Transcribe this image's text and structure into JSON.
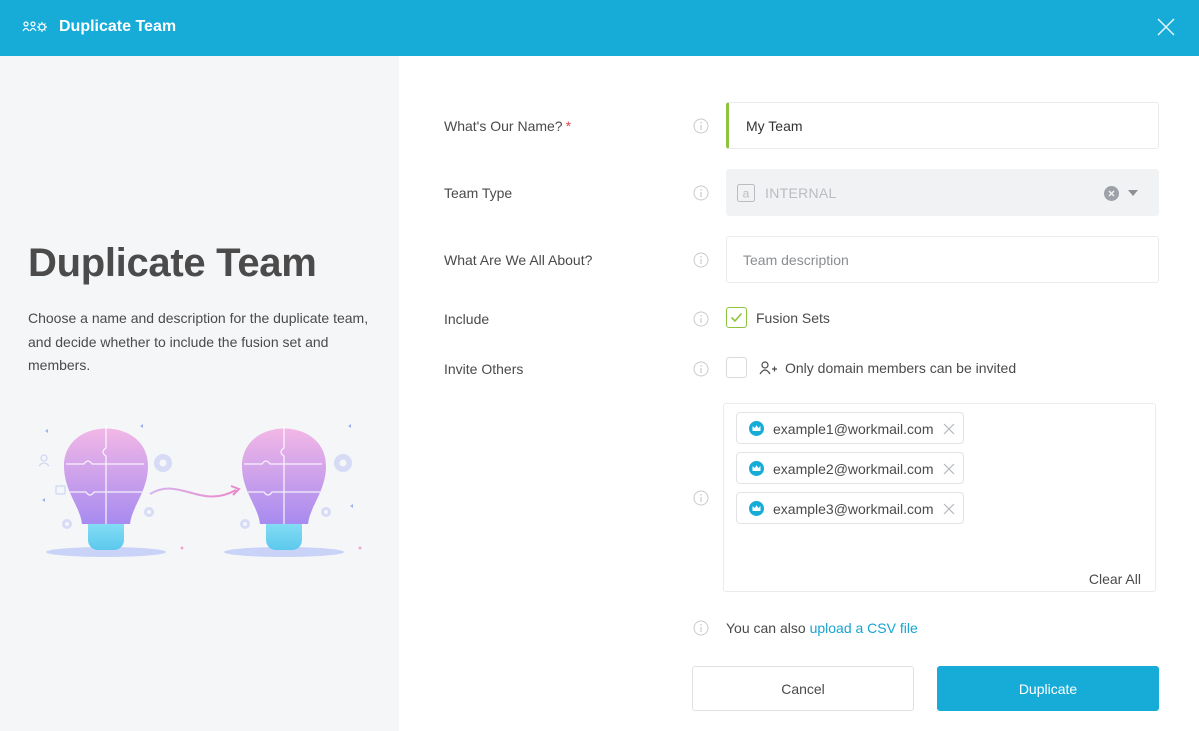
{
  "header": {
    "title": "Duplicate Team",
    "icon": "team-icon",
    "close_icon": "close-icon"
  },
  "left": {
    "title": "Duplicate Team",
    "description": "Choose a name and description for the duplicate team, and decide whether to include the fusion set and members."
  },
  "form": {
    "name": {
      "label": "What's Our Name?",
      "required_mark": "*",
      "value": "My Team"
    },
    "team_type": {
      "label": "Team Type",
      "value": "INTERNAL"
    },
    "about": {
      "label": "What Are We All About?",
      "placeholder": "Team description",
      "value": ""
    },
    "include": {
      "label": "Include",
      "option": "Fusion Sets",
      "checked": true
    },
    "invite": {
      "label": "Invite Others",
      "option": "Only domain members can be invited",
      "checked": false
    },
    "emails": [
      "example1@workmail.com",
      "example2@workmail.com",
      "example3@workmail.com"
    ],
    "clear_all": "Clear All",
    "csv_prefix": "You can also",
    "csv_link": "upload a CSV file"
  },
  "buttons": {
    "cancel": "Cancel",
    "duplicate": "Duplicate"
  },
  "colors": {
    "brand": "#17abd8",
    "accent_green": "#8cc43f",
    "link": "#17a3d3",
    "required": "#e0464a"
  }
}
